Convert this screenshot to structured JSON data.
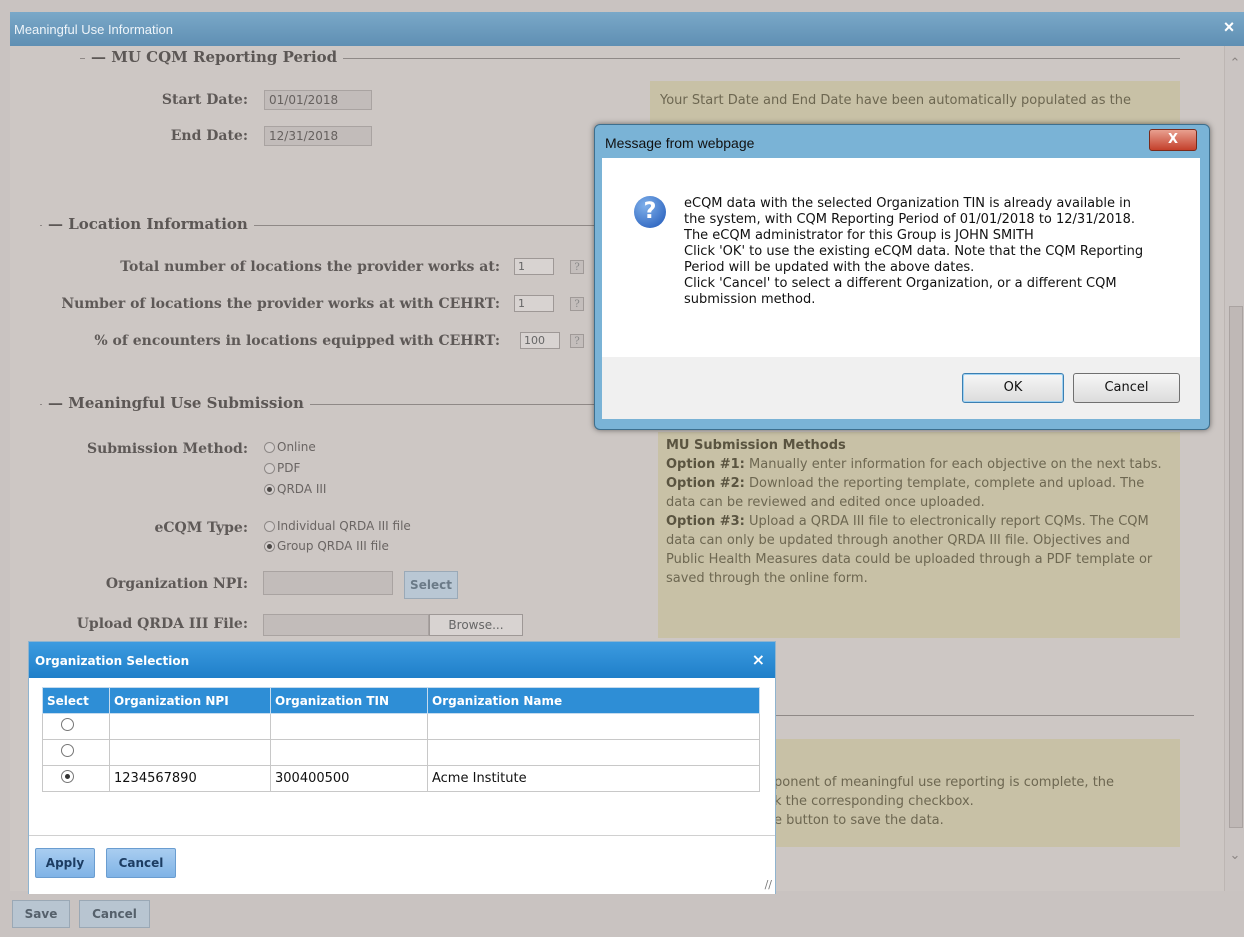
{
  "main_dialog": {
    "title": "Meaningful Use Information",
    "close": "×"
  },
  "reporting_period": {
    "legend": "MU CQM Reporting Period",
    "start_label": "Start Date:",
    "start_value": "01/01/2018",
    "end_label": "End Date:",
    "end_value": "12/31/2018",
    "info": "Your Start Date and End Date have been automatically populated as the"
  },
  "location": {
    "legend": "Location Information",
    "rows": [
      {
        "label": "Total number of locations the provider works at:",
        "value": "1"
      },
      {
        "label": "Number of locations the provider works at with CEHRT:",
        "value": "1"
      },
      {
        "label": "% of encounters in locations equipped with CEHRT:",
        "value": "100"
      }
    ],
    "help": "?"
  },
  "submission": {
    "legend": "Meaningful Use Submission",
    "method_label": "Submission Method:",
    "methods": [
      "Online",
      "PDF",
      "QRDA III"
    ],
    "ecqm_label": "eCQM Type:",
    "ecqm_types": [
      "Individual QRDA III file",
      "Group QRDA III file"
    ],
    "npi_label": "Organization NPI:",
    "select_label": "Select",
    "upload_label": "Upload QRDA III File:",
    "browse_label": "Browse...",
    "methods_title": "MU Submission Methods",
    "options": [
      {
        "head": "Option #1:",
        "text": " Manually enter information for each objective on the next tabs."
      },
      {
        "head": "Option #2:",
        "text": " Download the reporting template, complete and upload. The data can be reviewed and edited once uploaded."
      },
      {
        "head": "Option #3:",
        "text": " Upload a QRDA III file to electronically report CQMs. The CQM data can only be updated through another QRDA III file. Objectives and Public Health Measures data could be uploaded through a PDF template or saved through the online form."
      }
    ]
  },
  "bottom_info": {
    "lines": [
      "ponent of meaningful use reporting is complete, the",
      "k the corresponding checkbox.",
      "e button to save the data."
    ]
  },
  "message_box": {
    "title": "Message from webpage",
    "close": "X",
    "icon": "?",
    "text": "eCQM data with the selected Organization TIN is already available in\nthe system, with CQM Reporting Period of 01/01/2018 to 12/31/2018.\nThe eCQM administrator for this Group is  JOHN SMITH\nClick 'OK' to use the existing eCQM data. Note that the CQM Reporting\nPeriod will be updated with the above dates.\nClick 'Cancel' to select a different Organization, or a different CQM\nsubmission method.",
    "ok": "OK",
    "cancel": "Cancel"
  },
  "org_dialog": {
    "title": "Organization Selection",
    "close": "×",
    "columns": [
      "Select",
      "Organization NPI",
      "Organization TIN",
      "Organization Name"
    ],
    "rows": [
      {
        "selected": false,
        "npi": "",
        "tin": "",
        "name": ""
      },
      {
        "selected": false,
        "npi": "",
        "tin": "",
        "name": ""
      },
      {
        "selected": true,
        "npi": "1234567890",
        "tin": "300400500",
        "name": "Acme Institute"
      }
    ],
    "apply": "Apply",
    "cancel": "Cancel"
  },
  "footer": {
    "save": "Save",
    "cancel": "Cancel"
  }
}
